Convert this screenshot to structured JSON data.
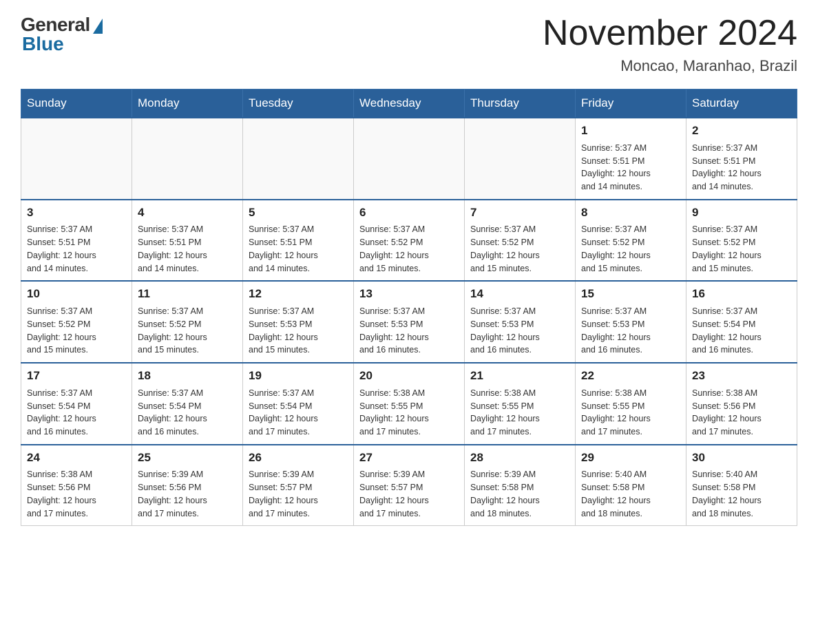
{
  "header": {
    "logo_general": "General",
    "logo_blue": "Blue",
    "title": "November 2024",
    "location": "Moncao, Maranhao, Brazil"
  },
  "weekdays": [
    "Sunday",
    "Monday",
    "Tuesday",
    "Wednesday",
    "Thursday",
    "Friday",
    "Saturday"
  ],
  "weeks": [
    [
      {
        "day": "",
        "info": ""
      },
      {
        "day": "",
        "info": ""
      },
      {
        "day": "",
        "info": ""
      },
      {
        "day": "",
        "info": ""
      },
      {
        "day": "",
        "info": ""
      },
      {
        "day": "1",
        "info": "Sunrise: 5:37 AM\nSunset: 5:51 PM\nDaylight: 12 hours\nand 14 minutes."
      },
      {
        "day": "2",
        "info": "Sunrise: 5:37 AM\nSunset: 5:51 PM\nDaylight: 12 hours\nand 14 minutes."
      }
    ],
    [
      {
        "day": "3",
        "info": "Sunrise: 5:37 AM\nSunset: 5:51 PM\nDaylight: 12 hours\nand 14 minutes."
      },
      {
        "day": "4",
        "info": "Sunrise: 5:37 AM\nSunset: 5:51 PM\nDaylight: 12 hours\nand 14 minutes."
      },
      {
        "day": "5",
        "info": "Sunrise: 5:37 AM\nSunset: 5:51 PM\nDaylight: 12 hours\nand 14 minutes."
      },
      {
        "day": "6",
        "info": "Sunrise: 5:37 AM\nSunset: 5:52 PM\nDaylight: 12 hours\nand 15 minutes."
      },
      {
        "day": "7",
        "info": "Sunrise: 5:37 AM\nSunset: 5:52 PM\nDaylight: 12 hours\nand 15 minutes."
      },
      {
        "day": "8",
        "info": "Sunrise: 5:37 AM\nSunset: 5:52 PM\nDaylight: 12 hours\nand 15 minutes."
      },
      {
        "day": "9",
        "info": "Sunrise: 5:37 AM\nSunset: 5:52 PM\nDaylight: 12 hours\nand 15 minutes."
      }
    ],
    [
      {
        "day": "10",
        "info": "Sunrise: 5:37 AM\nSunset: 5:52 PM\nDaylight: 12 hours\nand 15 minutes."
      },
      {
        "day": "11",
        "info": "Sunrise: 5:37 AM\nSunset: 5:52 PM\nDaylight: 12 hours\nand 15 minutes."
      },
      {
        "day": "12",
        "info": "Sunrise: 5:37 AM\nSunset: 5:53 PM\nDaylight: 12 hours\nand 15 minutes."
      },
      {
        "day": "13",
        "info": "Sunrise: 5:37 AM\nSunset: 5:53 PM\nDaylight: 12 hours\nand 16 minutes."
      },
      {
        "day": "14",
        "info": "Sunrise: 5:37 AM\nSunset: 5:53 PM\nDaylight: 12 hours\nand 16 minutes."
      },
      {
        "day": "15",
        "info": "Sunrise: 5:37 AM\nSunset: 5:53 PM\nDaylight: 12 hours\nand 16 minutes."
      },
      {
        "day": "16",
        "info": "Sunrise: 5:37 AM\nSunset: 5:54 PM\nDaylight: 12 hours\nand 16 minutes."
      }
    ],
    [
      {
        "day": "17",
        "info": "Sunrise: 5:37 AM\nSunset: 5:54 PM\nDaylight: 12 hours\nand 16 minutes."
      },
      {
        "day": "18",
        "info": "Sunrise: 5:37 AM\nSunset: 5:54 PM\nDaylight: 12 hours\nand 16 minutes."
      },
      {
        "day": "19",
        "info": "Sunrise: 5:37 AM\nSunset: 5:54 PM\nDaylight: 12 hours\nand 17 minutes."
      },
      {
        "day": "20",
        "info": "Sunrise: 5:38 AM\nSunset: 5:55 PM\nDaylight: 12 hours\nand 17 minutes."
      },
      {
        "day": "21",
        "info": "Sunrise: 5:38 AM\nSunset: 5:55 PM\nDaylight: 12 hours\nand 17 minutes."
      },
      {
        "day": "22",
        "info": "Sunrise: 5:38 AM\nSunset: 5:55 PM\nDaylight: 12 hours\nand 17 minutes."
      },
      {
        "day": "23",
        "info": "Sunrise: 5:38 AM\nSunset: 5:56 PM\nDaylight: 12 hours\nand 17 minutes."
      }
    ],
    [
      {
        "day": "24",
        "info": "Sunrise: 5:38 AM\nSunset: 5:56 PM\nDaylight: 12 hours\nand 17 minutes."
      },
      {
        "day": "25",
        "info": "Sunrise: 5:39 AM\nSunset: 5:56 PM\nDaylight: 12 hours\nand 17 minutes."
      },
      {
        "day": "26",
        "info": "Sunrise: 5:39 AM\nSunset: 5:57 PM\nDaylight: 12 hours\nand 17 minutes."
      },
      {
        "day": "27",
        "info": "Sunrise: 5:39 AM\nSunset: 5:57 PM\nDaylight: 12 hours\nand 17 minutes."
      },
      {
        "day": "28",
        "info": "Sunrise: 5:39 AM\nSunset: 5:58 PM\nDaylight: 12 hours\nand 18 minutes."
      },
      {
        "day": "29",
        "info": "Sunrise: 5:40 AM\nSunset: 5:58 PM\nDaylight: 12 hours\nand 18 minutes."
      },
      {
        "day": "30",
        "info": "Sunrise: 5:40 AM\nSunset: 5:58 PM\nDaylight: 12 hours\nand 18 minutes."
      }
    ]
  ]
}
